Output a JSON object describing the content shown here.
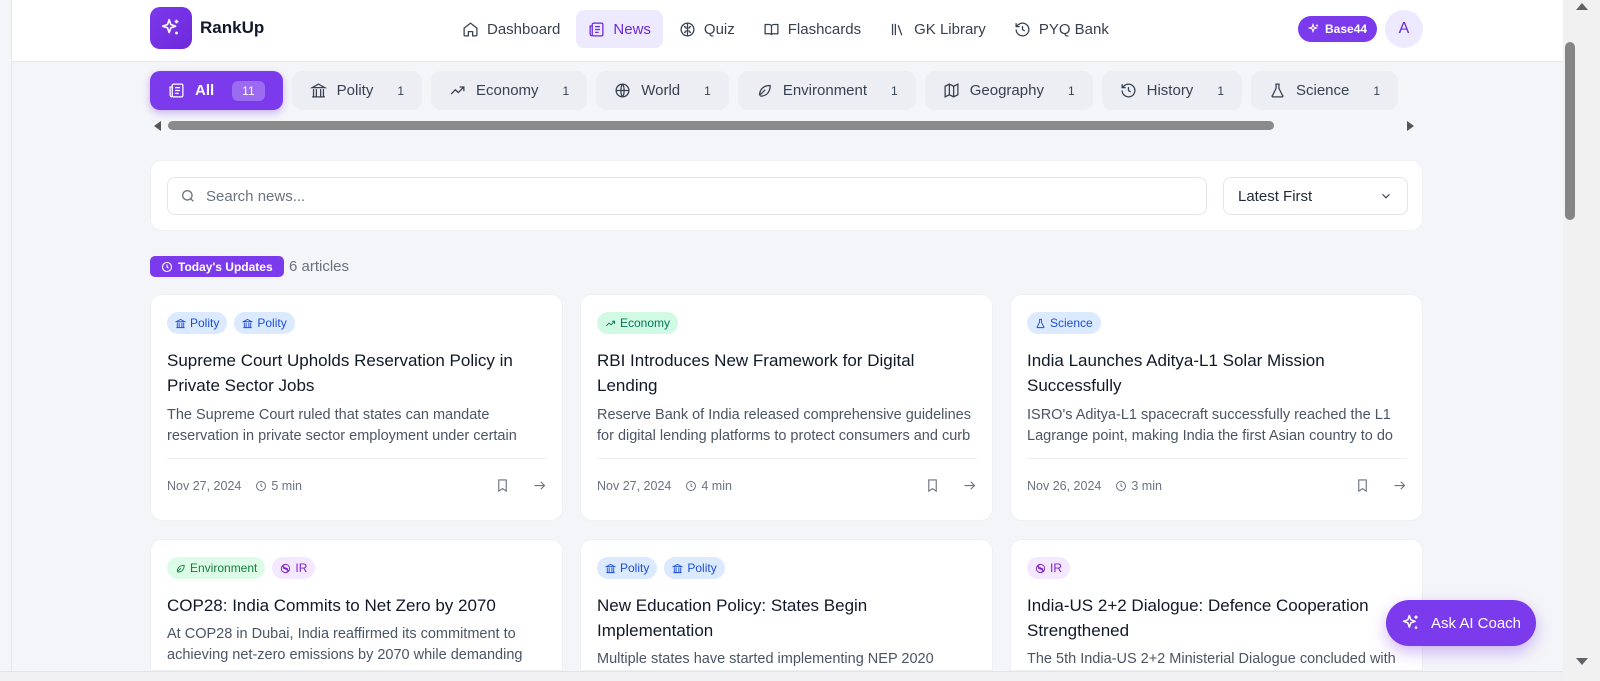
{
  "app": {
    "brand": "RankUp"
  },
  "nav": [
    {
      "label": "Dashboard",
      "icon": "home-icon"
    },
    {
      "label": "News",
      "icon": "newspaper-icon",
      "active": true
    },
    {
      "label": "Quiz",
      "icon": "brain-icon"
    },
    {
      "label": "Flashcards",
      "icon": "book-open-icon"
    },
    {
      "label": "GK Library",
      "icon": "library-icon"
    },
    {
      "label": "PYQ Bank",
      "icon": "history-icon"
    }
  ],
  "header": {
    "badge": "Base44",
    "avatar": "A"
  },
  "categories": [
    {
      "label": "All",
      "count": "11",
      "active": true
    },
    {
      "label": "Polity",
      "count": "1"
    },
    {
      "label": "Economy",
      "count": "1"
    },
    {
      "label": "World",
      "count": "1"
    },
    {
      "label": "Environment",
      "count": "1"
    },
    {
      "label": "Geography",
      "count": "1"
    },
    {
      "label": "History",
      "count": "1"
    },
    {
      "label": "Science",
      "count": "1"
    }
  ],
  "search": {
    "placeholder": "Search news...",
    "value": ""
  },
  "sort": {
    "selected": "Latest First"
  },
  "today": {
    "label": "Today's Updates",
    "count": "6 articles"
  },
  "cards": [
    {
      "tags": [
        "Polity",
        "Polity"
      ],
      "title": "Supreme Court Upholds Reservation Policy in Private Sector Jobs",
      "summary": "The Supreme Court ruled that states can mandate reservation in private sector employment under certain conditions.",
      "date": "Nov 27, 2024",
      "read": "5 min"
    },
    {
      "tags": [
        "Economy"
      ],
      "title": "RBI Introduces New Framework for Digital Lending",
      "summary": "Reserve Bank of India released comprehensive guidelines for digital lending platforms to protect consumers and curb malpractice.",
      "date": "Nov 27, 2024",
      "read": "4 min"
    },
    {
      "tags": [
        "Science"
      ],
      "title": "India Launches Aditya-L1 Solar Mission Successfully",
      "summary": "ISRO's Aditya-L1 spacecraft successfully reached the L1 Lagrange point, making India the first Asian country to do so.",
      "date": "Nov 26, 2024",
      "read": "3 min"
    },
    {
      "tags": [
        "Environment",
        "IR"
      ],
      "title": "COP28: India Commits to Net Zero by 2070",
      "summary": "At COP28 in Dubai, India reaffirmed its commitment to achieving net-zero emissions by 2070 while demanding climate finance.",
      "date": "",
      "read": ""
    },
    {
      "tags": [
        "Polity",
        "Polity"
      ],
      "title": "New Education Policy: States Begin Implementation",
      "summary": "Multiple states have started implementing NEP 2020",
      "date": "",
      "read": ""
    },
    {
      "tags": [
        "IR"
      ],
      "title": "India-US 2+2 Dialogue: Defence Cooperation Strengthened",
      "summary": "The 5th India-US 2+2 Ministerial Dialogue concluded with",
      "date": "",
      "read": ""
    }
  ],
  "coach": {
    "label": "Ask AI Coach"
  }
}
